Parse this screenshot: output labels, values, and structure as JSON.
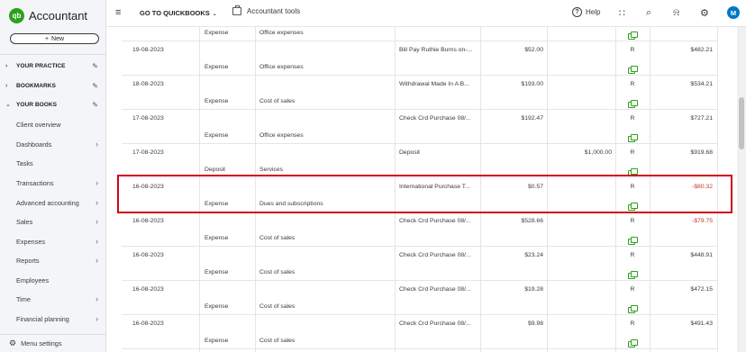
{
  "brand": {
    "logo_text": "qb",
    "app_name": "Accountant"
  },
  "sidebar": {
    "new_label": "New",
    "sections": [
      {
        "label": "YOUR PRACTICE"
      },
      {
        "label": "BOOKMARKS"
      },
      {
        "label": "YOUR BOOKS"
      }
    ],
    "items": [
      {
        "label": "Client overview"
      },
      {
        "label": "Dashboards"
      },
      {
        "label": "Tasks"
      },
      {
        "label": "Transactions"
      },
      {
        "label": "Advanced accounting"
      },
      {
        "label": "Sales"
      },
      {
        "label": "Expenses"
      },
      {
        "label": "Reports"
      },
      {
        "label": "Employees"
      },
      {
        "label": "Time"
      },
      {
        "label": "Financial planning"
      }
    ],
    "menu_settings": "Menu settings"
  },
  "topbar": {
    "goto": "GO TO QUICKBOOKS",
    "accountant_tools": "Accountant tools",
    "help": "Help",
    "avatar": "M"
  },
  "register": {
    "rows": [
      {
        "date": "",
        "type": "Expense",
        "account": "Office expenses",
        "payee": "",
        "payment": "",
        "deposit": "",
        "status": "",
        "balance": "",
        "attach": true,
        "top_partial": true
      },
      {
        "date": "19-08-2023",
        "type": "",
        "account": "",
        "payee": "Bill Pay Ruthie Burns on-...",
        "payment": "$52.00",
        "deposit": "",
        "status": "R",
        "balance": "$482.21",
        "attach": false
      },
      {
        "date": "",
        "type": "Expense",
        "account": "Office expenses",
        "payee": "",
        "payment": "",
        "deposit": "",
        "status": "",
        "balance": "",
        "attach": true
      },
      {
        "date": "18-08-2023",
        "type": "",
        "account": "",
        "payee": "Withdrawal Made In A B...",
        "payment": "$193.00",
        "deposit": "",
        "status": "R",
        "balance": "$534.21",
        "attach": false
      },
      {
        "date": "",
        "type": "Expense",
        "account": "Cost of sales",
        "payee": "",
        "payment": "",
        "deposit": "",
        "status": "",
        "balance": "",
        "attach": true
      },
      {
        "date": "17-08-2023",
        "type": "",
        "account": "",
        "payee": "Check Crd Purchase 08/...",
        "payment": "$192.47",
        "deposit": "",
        "status": "R",
        "balance": "$727.21",
        "attach": false
      },
      {
        "date": "",
        "type": "Expense",
        "account": "Office expenses",
        "payee": "",
        "payment": "",
        "deposit": "",
        "status": "",
        "balance": "",
        "attach": true
      },
      {
        "date": "17-08-2023",
        "type": "",
        "account": "",
        "payee": "Deposit",
        "payment": "",
        "deposit": "$1,000.00",
        "status": "R",
        "balance": "$919.68",
        "attach": false
      },
      {
        "date": "",
        "type": "Deposit",
        "account": "Services",
        "payee": "",
        "payment": "",
        "deposit": "",
        "status": "",
        "balance": "",
        "attach": true
      },
      {
        "date": "16-08-2023",
        "type": "",
        "account": "",
        "payee": "International Purchase T...",
        "payment": "$0.57",
        "deposit": "",
        "status": "R",
        "balance": "-$80.32",
        "attach": false,
        "negative": true
      },
      {
        "date": "",
        "type": "Expense",
        "account": "Dues and subscriptions",
        "payee": "",
        "payment": "",
        "deposit": "",
        "status": "",
        "balance": "",
        "attach": true
      },
      {
        "date": "16-08-2023",
        "type": "",
        "account": "",
        "payee": "Check Crd Purchase 08/...",
        "payment": "$528.66",
        "deposit": "",
        "status": "R",
        "balance": "-$79.75",
        "attach": false,
        "negative": true
      },
      {
        "date": "",
        "type": "Expense",
        "account": "Cost of sales",
        "payee": "",
        "payment": "",
        "deposit": "",
        "status": "",
        "balance": "",
        "attach": true
      },
      {
        "date": "16-08-2023",
        "type": "",
        "account": "",
        "payee": "Check Crd Purchase 08/...",
        "payment": "$23.24",
        "deposit": "",
        "status": "R",
        "balance": "$448.91",
        "attach": false
      },
      {
        "date": "",
        "type": "Expense",
        "account": "Cost of sales",
        "payee": "",
        "payment": "",
        "deposit": "",
        "status": "",
        "balance": "",
        "attach": true
      },
      {
        "date": "16-08-2023",
        "type": "",
        "account": "",
        "payee": "Check Crd Purchase 08/...",
        "payment": "$19.28",
        "deposit": "",
        "status": "R",
        "balance": "$472.15",
        "attach": false
      },
      {
        "date": "",
        "type": "Expense",
        "account": "Cost of sales",
        "payee": "",
        "payment": "",
        "deposit": "",
        "status": "",
        "balance": "",
        "attach": true
      },
      {
        "date": "16-08-2023",
        "type": "",
        "account": "",
        "payee": "Check Crd Purchase 08/...",
        "payment": "$9.98",
        "deposit": "",
        "status": "R",
        "balance": "$491.43",
        "attach": false
      },
      {
        "date": "",
        "type": "Expense",
        "account": "Cost of sales",
        "payee": "",
        "payment": "",
        "deposit": "",
        "status": "",
        "balance": "",
        "attach": true
      }
    ]
  },
  "colors": {
    "brand_green": "#2ca01c",
    "negative_red": "#c0392b",
    "highlight_red": "#d0021b",
    "avatar_blue": "#0077c5"
  },
  "icons": {
    "hamburger": "hamburger-icon",
    "help": "help-icon",
    "apps": "apps-grid-icon",
    "search": "search-icon",
    "bell": "bell-icon",
    "gear": "gear-icon",
    "attachment": "attachment-icon",
    "pencil": "pencil-icon",
    "chevron": "chevron-right-icon"
  }
}
